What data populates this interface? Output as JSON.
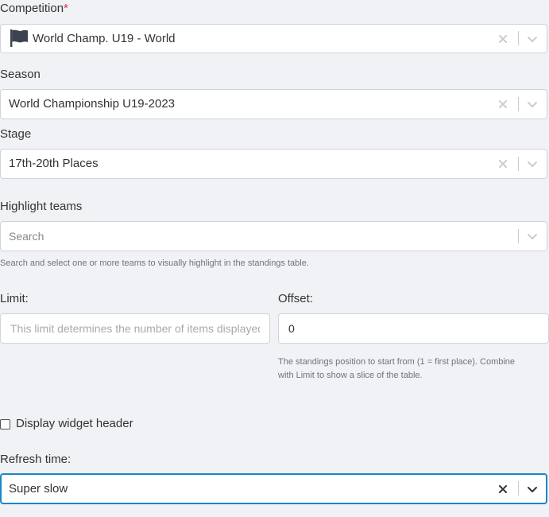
{
  "competition": {
    "label": "Competition",
    "required_marker": "*",
    "value": "World Champ. U19 - World"
  },
  "season": {
    "label": "Season",
    "value": "World Championship U19-2023"
  },
  "stage": {
    "label": "Stage",
    "value": "17th-20th Places"
  },
  "highlight_teams": {
    "label": "Highlight teams",
    "placeholder": "Search",
    "help": "Search and select one or more teams to visually highlight in the standings table."
  },
  "limit": {
    "label": "Limit:",
    "placeholder": "This limit determines the number of items displayed",
    "value": ""
  },
  "offset": {
    "label": "Offset:",
    "value": "0",
    "help_line1": "The standings position to start from (1 = first place). Combine",
    "help_line2": "with Limit to show a slice of the table."
  },
  "display_header": {
    "label": "Display widget header",
    "checked": false
  },
  "refresh_time": {
    "label": "Refresh time:",
    "value": "Super slow"
  },
  "icons": {
    "clear": "close-icon",
    "dropdown": "chevron-down-icon",
    "flag": "flag-icon"
  },
  "colors": {
    "required": "#dc3545",
    "focus_border": "#1a86c8",
    "background": "#f0f2f5"
  }
}
